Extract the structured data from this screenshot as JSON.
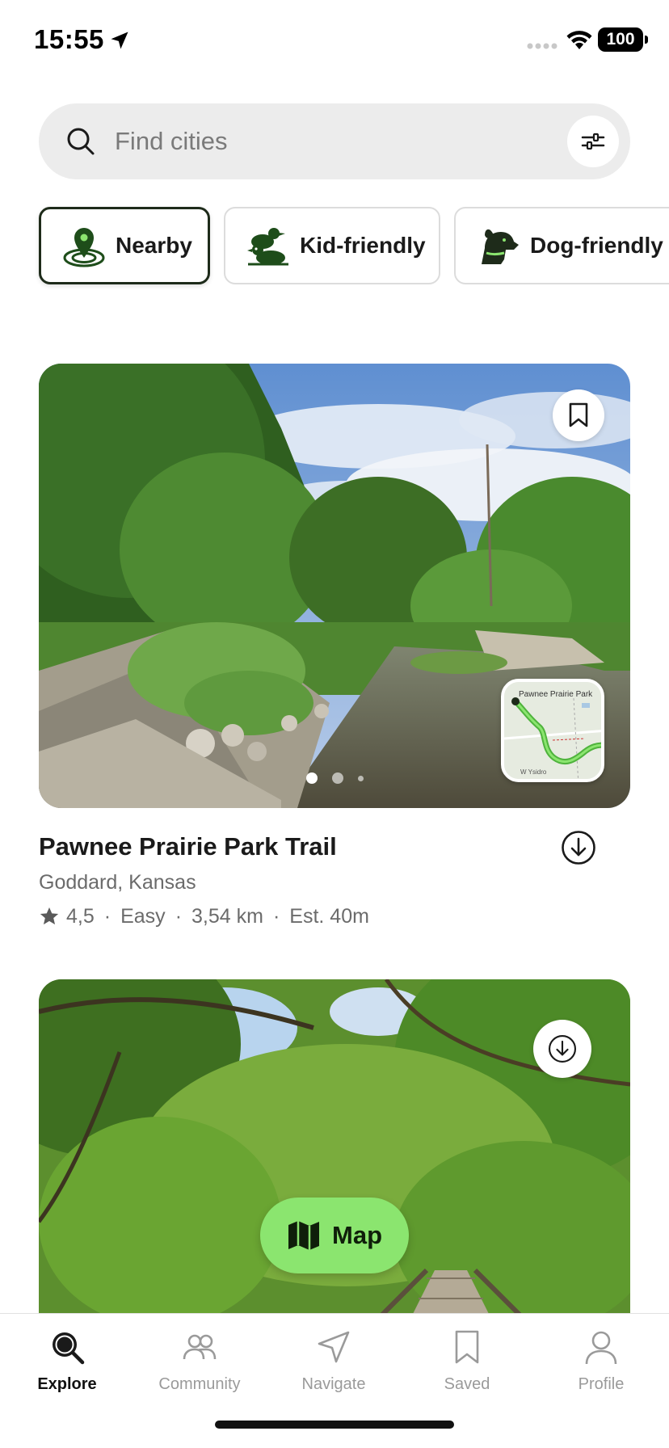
{
  "status_bar": {
    "time": "15:55",
    "battery": "100"
  },
  "search": {
    "placeholder": "Find cities",
    "value": ""
  },
  "chips": [
    {
      "label": "Nearby",
      "icon": "nearby-pin-icon",
      "active": true
    },
    {
      "label": "Kid-friendly",
      "icon": "ducks-icon",
      "active": false
    },
    {
      "label": "Dog-friendly",
      "icon": "dog-icon",
      "active": false
    }
  ],
  "trails": [
    {
      "title": "Pawnee Prairie Park Trail",
      "location": "Goddard, Kansas",
      "rating": "4,5",
      "difficulty": "Easy",
      "distance": "3,54 km",
      "duration": "Est. 40m",
      "map_label": "Pawnee Prairie Park",
      "map_road": "W Ysidro",
      "photo_count": 3,
      "current_photo": 1
    }
  ],
  "map_button": {
    "label": "Map",
    "icon": "map-icon"
  },
  "tabs": [
    {
      "label": "Explore",
      "icon": "explore-search-icon",
      "active": true
    },
    {
      "label": "Community",
      "icon": "community-icon",
      "active": false
    },
    {
      "label": "Navigate",
      "icon": "navigate-icon",
      "active": false
    },
    {
      "label": "Saved",
      "icon": "bookmark-icon",
      "active": false
    },
    {
      "label": "Profile",
      "icon": "profile-icon",
      "active": false
    }
  ],
  "colors": {
    "accent_green": "#8be56f",
    "dark_green": "#1e2b1a",
    "muted_text": "#6b6b6b"
  }
}
